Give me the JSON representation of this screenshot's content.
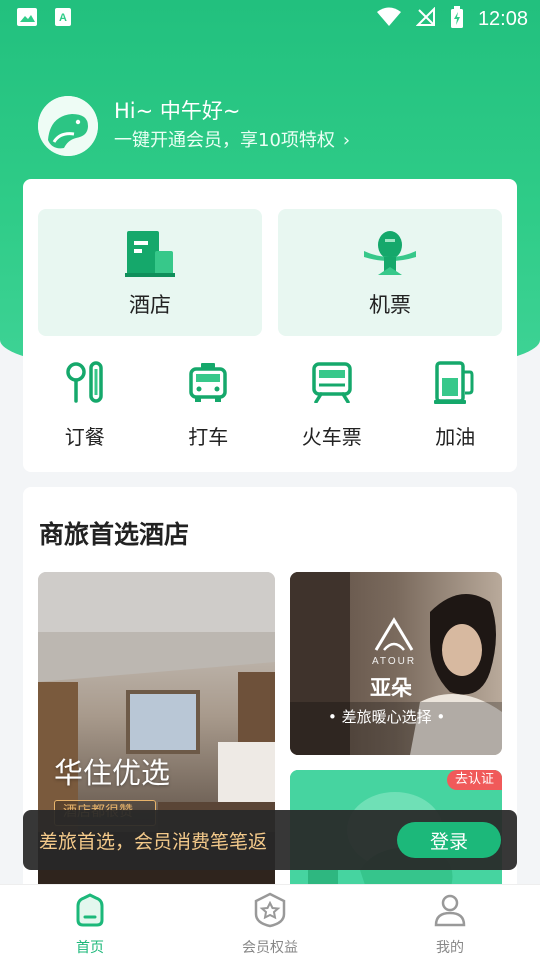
{
  "status_bar": {
    "time": "12:08",
    "icons": [
      "image-icon",
      "app-store-icon",
      "wifi-icon",
      "no-signal-icon",
      "battery-charging-icon"
    ]
  },
  "greeting": {
    "title": "Hi~ 中午好~",
    "subtitle": "一键开通会员，享10项特权",
    "chevron": "›"
  },
  "services": {
    "primary": [
      {
        "label": "酒店",
        "icon": "hotel-building-icon"
      },
      {
        "label": "机票",
        "icon": "airplane-icon"
      }
    ],
    "secondary": [
      {
        "label": "订餐",
        "icon": "dining-icon"
      },
      {
        "label": "打车",
        "icon": "car-icon"
      },
      {
        "label": "火车票",
        "icon": "train-icon"
      },
      {
        "label": "加油",
        "icon": "fuel-icon"
      }
    ]
  },
  "hotels": {
    "title": "商旅首选酒店",
    "main": {
      "name": "华住优选",
      "tag": "酒店都很赞"
    },
    "atour": {
      "brand_en": "ATOUR",
      "name": "亚朵",
      "slogan": "• 差旅暖心选择 •"
    },
    "promo": {
      "badge": "去认证"
    }
  },
  "toast": {
    "text": "差旅首选，会员消费笔笔返",
    "button": "登录"
  },
  "bottom_nav": [
    {
      "label": "首页",
      "icon": "home-icon",
      "active": true
    },
    {
      "label": "会员权益",
      "icon": "member-badge-icon",
      "active": false
    },
    {
      "label": "我的",
      "icon": "profile-icon",
      "active": false
    }
  ],
  "colors": {
    "brand_green": "#1cb87a",
    "toast_text": "#f3c98a",
    "badge_red": "#f05a5a"
  }
}
